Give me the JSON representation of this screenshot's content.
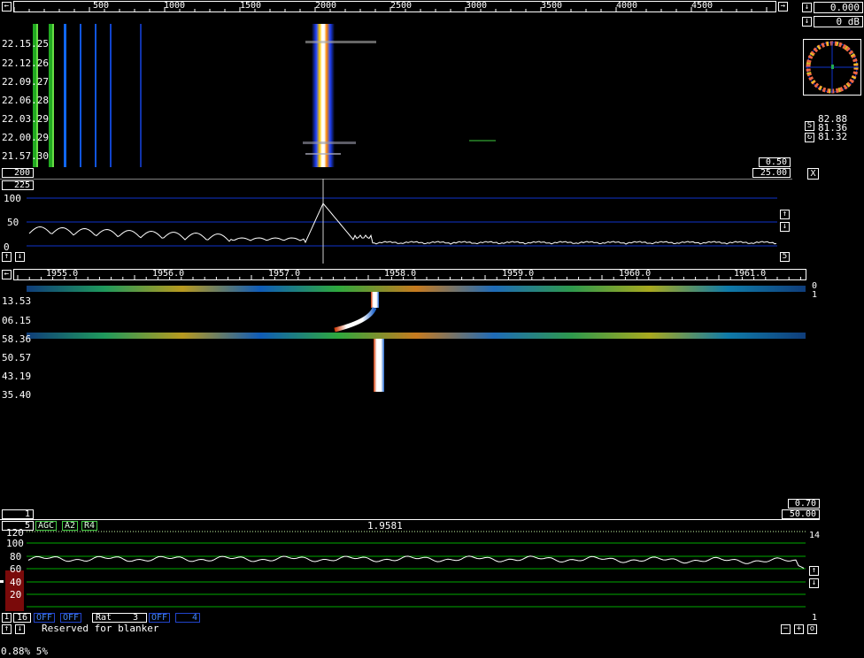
{
  "top_scale": {
    "ticks": [
      "500",
      "1000",
      "1500",
      "2000",
      "2500",
      "3000",
      "3500",
      "4000",
      "4500"
    ]
  },
  "waterfall1": {
    "times": [
      "22.15.25",
      "22.12.26",
      "22.09.27",
      "22.06.28",
      "22.03.29",
      "22.00.29",
      "21.57.30"
    ],
    "bottom_left": "200",
    "right_top": "0.50",
    "right_bottom": "25.00"
  },
  "spectrum": {
    "top_left": "225",
    "ylabels": [
      "100",
      "50",
      "0"
    ],
    "right_num": "5"
  },
  "right_panel": {
    "value1": "0.000",
    "value2": "0 dB",
    "s_values": [
      "82.88",
      "81.36",
      "81.32"
    ],
    "s_label": "S",
    "close": "X"
  },
  "mid_scale": {
    "ticks": [
      "1955.0",
      "1956.0",
      "1957.0",
      "1958.0",
      "1959.0",
      "1960.0",
      "1961.0"
    ],
    "right_labels": [
      "0",
      "1"
    ]
  },
  "waterfall2": {
    "times": [
      "13.53",
      "06.15",
      "58.36",
      "50.57",
      "43.19",
      "35.40"
    ],
    "bottom_left": "1",
    "right_top": "0.70",
    "right_bottom": "50.00"
  },
  "controls": {
    "left_num": "5",
    "agc": "AGC",
    "a2": "A2",
    "r4": "R4",
    "freq": "1.9581"
  },
  "level": {
    "ylabels": [
      "120",
      "100",
      "80",
      "60",
      "40",
      "20"
    ],
    "right_top": "14",
    "right_bottom": "1"
  },
  "bottom_row": {
    "num16": "16",
    "off1": "OFF",
    "off2": "OFF",
    "rat": "Rat",
    "rat_val": "3",
    "off3": "OFF",
    "val4": "4"
  },
  "status": {
    "blanker": "Reserved for blanker",
    "footer": "0.88% 5%"
  },
  "colors": {
    "background": "#000000",
    "grid_blue": "#1133cc",
    "grid_green": "#00aa00",
    "trace": "#ffffff"
  }
}
